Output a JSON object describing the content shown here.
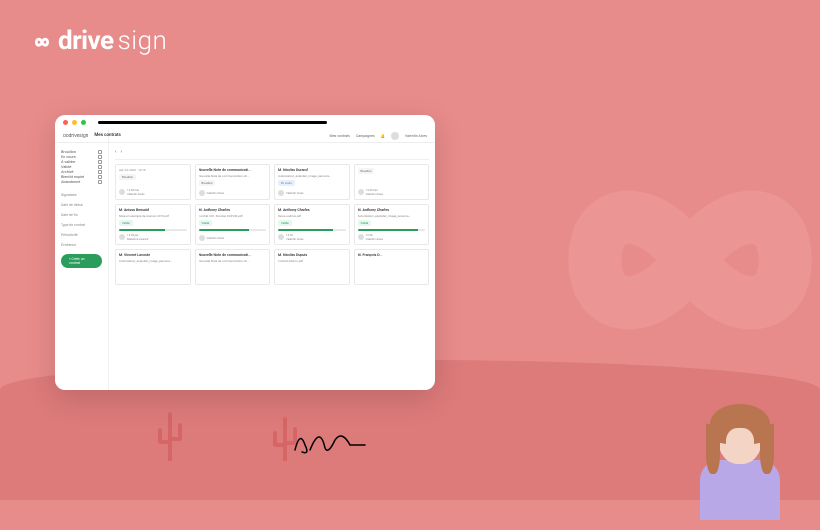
{
  "brand": {
    "drive": "drive",
    "sign": "sign",
    "infinity": "∞"
  },
  "app": {
    "logo_drive": "oodrive",
    "logo_sign": "sign",
    "page_title": "Mes contrats",
    "nav": {
      "contrats": "Mes contrats",
      "campagnes": "Campagnes",
      "user": "Valentin Alves"
    }
  },
  "sidebar": {
    "filters": [
      {
        "label": "Brouillon"
      },
      {
        "label": "En cours"
      },
      {
        "label": "À valider"
      },
      {
        "label": "Validé"
      },
      {
        "label": "Archivé"
      },
      {
        "label": "Bientôt expiré"
      },
      {
        "label": "Abandonné"
      }
    ],
    "sections": [
      "Signataire",
      "Date de début",
      "Date de fin",
      "Type de contrat",
      "Périodicité",
      "Échéance"
    ]
  },
  "toolbar": {
    "back": "‹",
    "fwd": "›"
  },
  "cards": [
    {
      "title": "",
      "sub": "Apr 24, 2023 · 10:15",
      "badge": "Brouillon",
      "badge_class": "",
      "footer": "Valentin Alves",
      "date": "14:30 hier"
    },
    {
      "title": "Nouvelle Note de communicati...",
      "sub": "Nouvelle Note de communication uti...",
      "badge": "Brouillon",
      "badge_class": "",
      "footer": "Valentin Alves",
      "date": ""
    },
    {
      "title": "M. Nicolas Durand",
      "sub": "Autorisation_exploiter_image_persona...",
      "badge": "En cours",
      "badge_class": "badge-blue",
      "footer": "Valentin Alves",
      "date": ""
    },
    {
      "title": "",
      "sub": "",
      "badge": "Brouillon",
      "badge_class": "",
      "footer": "Valentin Alves",
      "date": "14:30 hier"
    },
    {
      "title": "M. Anissa Bensaïd",
      "sub": "Mise en exemple de réunion 2019.pdf",
      "badge": "Validé",
      "badge_class": "badge-green",
      "footer": "Maxence Laurent",
      "date": "13:45 jeu"
    },
    {
      "title": "M. Anthony Charles",
      "sub": "Contrat CDI - Nicolas DUPUIS.pdf",
      "badge": "Validé",
      "badge_class": "badge-green",
      "footer": "Valentin Alves",
      "date": ""
    },
    {
      "title": "M. Anthony Charles",
      "sub": "Devis-oodrive.pdf",
      "badge": "Validé",
      "badge_class": "badge-green",
      "footer": "Valentin Alves",
      "date": "13:45"
    },
    {
      "title": "M. Anthony Charles",
      "sub": "Autorisation_exploiter_image_persona...",
      "badge": "Validé",
      "badge_class": "badge-green",
      "footer": "Valentin Alves",
      "date": "13:45"
    },
    {
      "title": "M. Vincent Lacoste",
      "sub": "Autorisation_exploiter_image_persona...",
      "badge": "",
      "badge_class": "",
      "footer": "",
      "date": ""
    },
    {
      "title": "Nouvelle Note de communicati...",
      "sub": "Nouvelle Note de communication uti...",
      "badge": "",
      "badge_class": "",
      "footer": "",
      "date": ""
    },
    {
      "title": "M. Nicolas Dupuis",
      "sub": "Contrat-interco.pdf",
      "badge": "",
      "badge_class": "",
      "footer": "",
      "date": ""
    },
    {
      "title": "M. François D...",
      "sub": "",
      "badge": "",
      "badge_class": "",
      "footer": "",
      "date": ""
    }
  ],
  "button_new": "« Créer un contrat"
}
